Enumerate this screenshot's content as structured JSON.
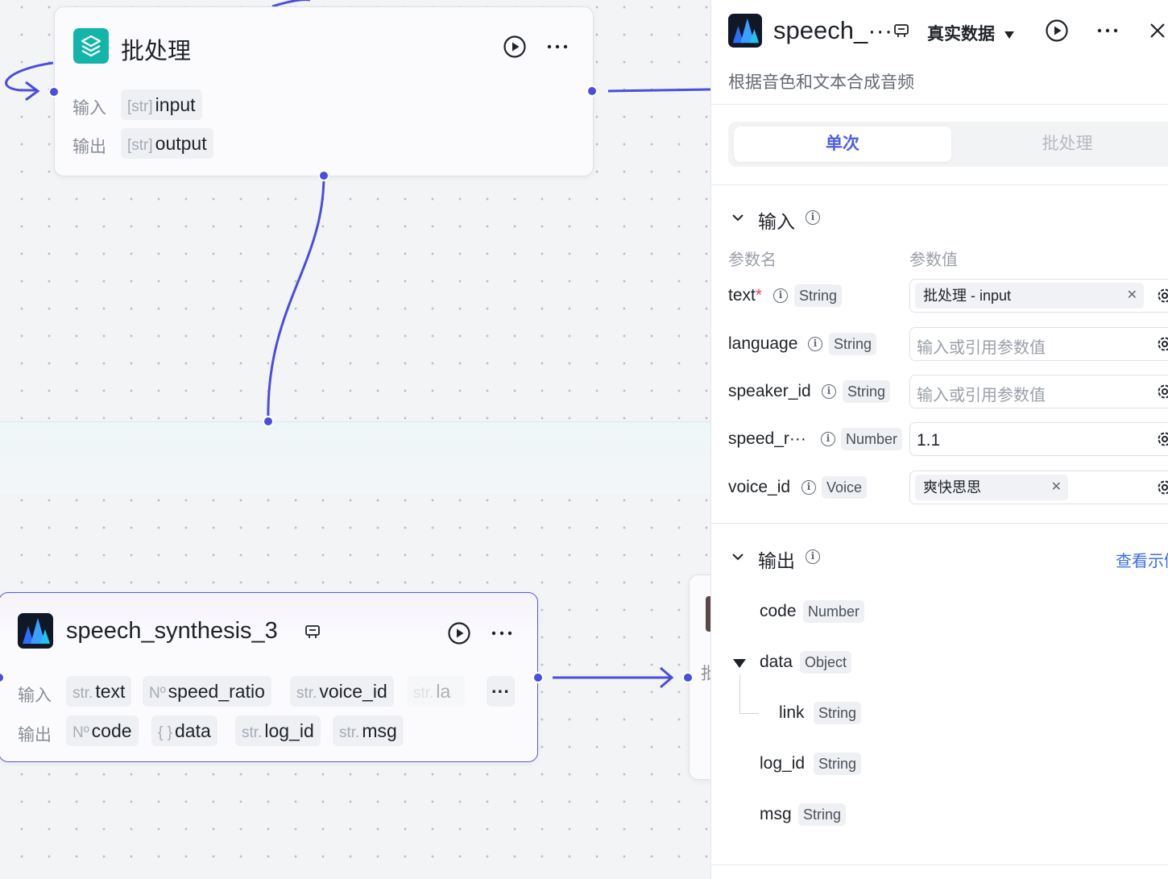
{
  "canvas": {
    "batch_node": {
      "title": "批处理",
      "input_label": "输入",
      "output_label": "输出",
      "input": {
        "type": "[str]",
        "name": "input"
      },
      "output": {
        "type": "[str]",
        "name": "output"
      }
    },
    "speech_node": {
      "title": "speech_synthesis_3",
      "input_label": "输入",
      "output_label": "输出",
      "inputs": [
        {
          "type": "str.",
          "name": "text"
        },
        {
          "type": "Nº",
          "name": "speed_ratio"
        },
        {
          "type": "str.",
          "name": "voice_id"
        },
        {
          "type": "str.",
          "name": "la"
        }
      ],
      "outputs": [
        {
          "type": "Nº",
          "name": "code"
        },
        {
          "type": "{ }",
          "name": "data"
        },
        {
          "type": "str.",
          "name": "log_id"
        },
        {
          "type": "str.",
          "name": "msg"
        }
      ],
      "more_label": "···"
    },
    "partial_node": {
      "label": "批"
    }
  },
  "panel": {
    "title": "speech_···",
    "data_mode": "真实数据",
    "description": "根据音色和文本合成音频",
    "tabs": [
      {
        "label": "单次",
        "active": true
      },
      {
        "label": "批处理",
        "active": false
      }
    ],
    "input_section": {
      "title": "输入",
      "col_name": "参数名",
      "col_value": "参数值",
      "params": [
        {
          "name": "text",
          "required": "*",
          "type": "String",
          "ref": "批处理 - input"
        },
        {
          "name": "language",
          "type": "String",
          "placeholder": "输入或引用参数值"
        },
        {
          "name": "speaker_id",
          "type": "String",
          "placeholder": "输入或引用参数值"
        },
        {
          "name": "speed_r···",
          "type": "Number",
          "value": "1.1"
        },
        {
          "name": "voice_id",
          "type": "Voice",
          "ref": "爽快思思"
        }
      ]
    },
    "output_section": {
      "title": "输出",
      "view_example": "查看示例",
      "fields": [
        {
          "name": "code",
          "type": "Number"
        },
        {
          "name": "data",
          "type": "Object"
        },
        {
          "name": "link",
          "type": "String"
        },
        {
          "name": "log_id",
          "type": "String"
        },
        {
          "name": "msg",
          "type": "String"
        }
      ]
    }
  },
  "colors": {
    "accent": "#4b4ddf",
    "link": "#3b6fe8",
    "tab_active": "#4e5ee8",
    "batch_icon": "#13b5a8"
  }
}
